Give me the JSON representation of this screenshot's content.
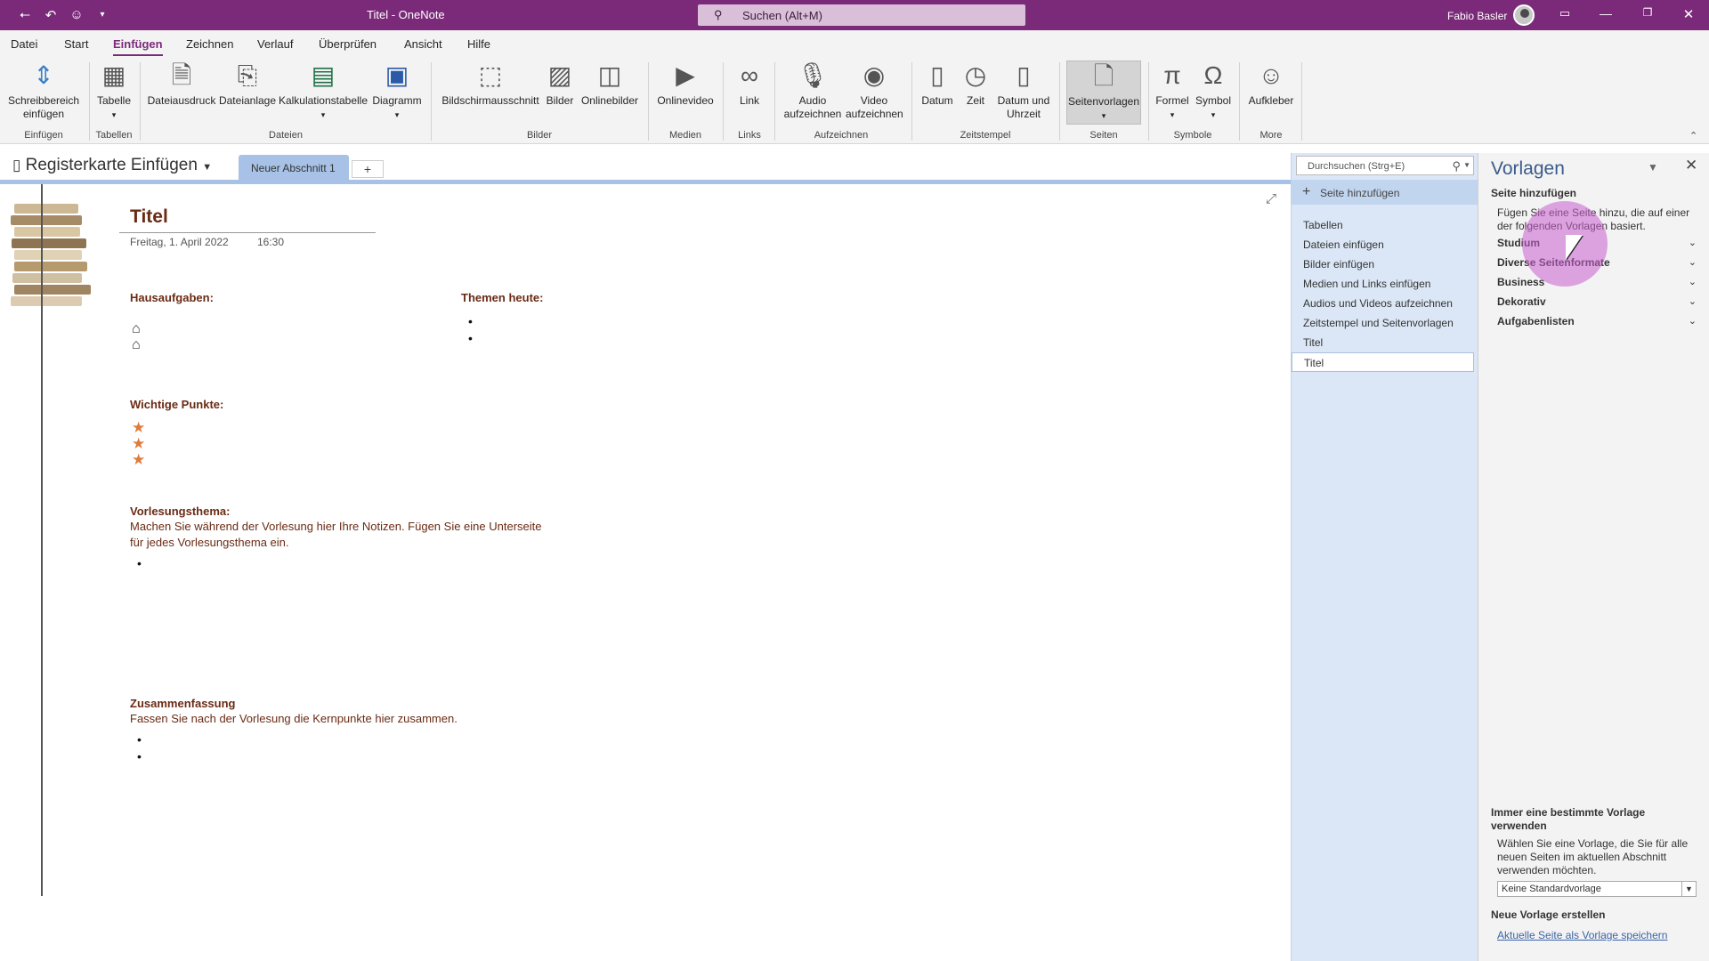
{
  "titlebar": {
    "title": "Titel  -  OneNote",
    "search_placeholder": "Suchen (Alt+M)",
    "user_name": "Fabio Basler",
    "icons": {
      "back": "back-arrow-icon",
      "undo": "undo-icon",
      "emoji": "emoji-icon",
      "customize": "chevron-down-icon"
    }
  },
  "menu": [
    "Datei",
    "Start",
    "Einfügen",
    "Zeichnen",
    "Verlauf",
    "Überprüfen",
    "Ansicht",
    "Hilfe"
  ],
  "menu_active": "Einfügen",
  "ribbon": {
    "buttons": {
      "schreibbereich": "Schreibbereich einfügen",
      "tabelle": "Tabelle",
      "dateiausdruck": "Dateiausdruck",
      "dateianlage": "Dateianlage",
      "kalkulationstabelle": "Kalkulationstabelle",
      "diagramm": "Diagramm",
      "bildschirmausschnitt": "Bildschirmausschnitt",
      "bilder": "Bilder",
      "onlinebilder": "Onlinebilder",
      "onlinevideo": "Onlinevideo",
      "link": "Link",
      "audio": "Audio aufzeichnen",
      "video": "Video aufzeichnen",
      "datum": "Datum",
      "zeit": "Zeit",
      "datum_uhrzeit": "Datum und Uhrzeit",
      "seitenvorlagen": "Seitenvorlagen",
      "formel": "Formel",
      "symbol": "Symbol",
      "aufkleber": "Aufkleber"
    },
    "groups": {
      "einfuegen": "Einfügen",
      "tabellen": "Tabellen",
      "dateien": "Dateien",
      "bilder": "Bilder",
      "medien": "Medien",
      "links": "Links",
      "aufzeichnen": "Aufzeichnen",
      "zeitstempel": "Zeitstempel",
      "seiten": "Seiten",
      "symbole": "Symbole",
      "more": "More"
    }
  },
  "notebook": {
    "name": "Registerkarte Einfügen",
    "section_tab": "Neuer Abschnitt 1",
    "add_tab": "+"
  },
  "page": {
    "title": "Titel",
    "date": "Freitag, 1. April 2022",
    "time": "16:30",
    "hausaufgaben": "Hausaufgaben:",
    "themen": "Themen heute:",
    "wichtige": "Wichtige Punkte:",
    "vorlesung_heading": "Vorlesungsthema:",
    "vorlesung_line1": "Machen Sie während der Vorlesung hier Ihre Notizen. Fügen Sie eine Unterseite",
    "vorlesung_line2": "für jedes Vorlesungsthema ein.",
    "zusammenfassung_heading": "Zusammenfassung",
    "zusammenfassung_text": "Fassen Sie nach der Vorlesung die Kernpunkte hier zusammen.",
    "bullet": "•",
    "house_glyph": "⌂",
    "star_glyph": "★"
  },
  "pagelist": {
    "search_placeholder": "Durchsuchen (Strg+E)",
    "add_page": "Seite hinzufügen",
    "items": [
      "Tabellen",
      "Dateien einfügen",
      "Bilder einfügen",
      "Medien und Links einfügen",
      "Audios und Videos aufzeichnen",
      "Zeitstempel und Seitenvorlagen",
      "Titel",
      "Titel"
    ],
    "selected_index": 7
  },
  "templates": {
    "title": "Vorlagen",
    "add_page_heading": "Seite hinzufügen",
    "add_page_desc": "Fügen Sie eine Seite hinzu, die auf einer der folgenden Vorlagen basiert.",
    "categories": [
      "Studium",
      "Diverse Seitenformate",
      "Business",
      "Dekorativ",
      "Aufgabenlisten"
    ],
    "default_heading": "Immer eine bestimmte Vorlage verwenden",
    "default_desc": "Wählen Sie eine Vorlage, die Sie für alle neuen Seiten im aktuellen Abschnitt verwenden möchten.",
    "default_value": "Keine Standardvorlage",
    "new_heading": "Neue Vorlage erstellen",
    "save_link": "Aktuelle Seite als Vorlage speichern"
  },
  "colors": {
    "titlebar": "#7b2a7a",
    "accent": "#7b2a7a",
    "note_text": "#6a2b14",
    "section_tab": "#a7c2e6",
    "star": "#e07b39",
    "link": "#3c63a8"
  }
}
